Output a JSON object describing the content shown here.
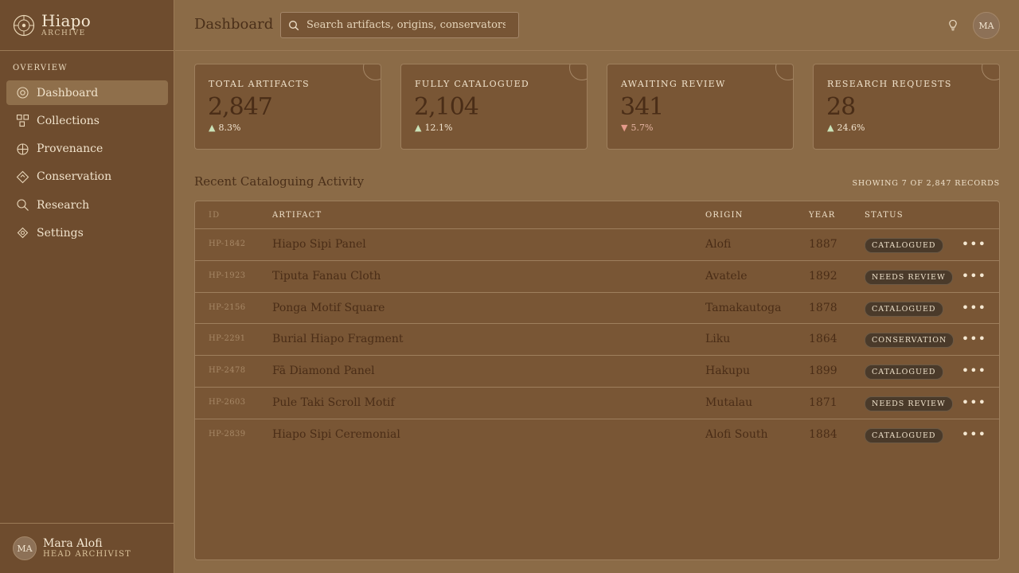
{
  "brand": {
    "name": "Hiapo",
    "subtitle": "ARCHIVE"
  },
  "sidebar": {
    "section": "OVERVIEW",
    "items": [
      {
        "label": "Dashboard",
        "icon": "dashboard-icon",
        "active": true
      },
      {
        "label": "Collections",
        "icon": "collections-icon"
      },
      {
        "label": "Provenance",
        "icon": "provenance-icon"
      },
      {
        "label": "Conservation",
        "icon": "conservation-icon"
      },
      {
        "label": "Research",
        "icon": "research-icon"
      },
      {
        "label": "Settings",
        "icon": "settings-icon"
      }
    ]
  },
  "user": {
    "initials": "MA",
    "name": "Mara Alofi",
    "role": "HEAD ARCHIVIST"
  },
  "header": {
    "title": "Dashboard",
    "search_placeholder": "Search artifacts, origins, conservators...",
    "avatar_initials": "MA"
  },
  "stats": [
    {
      "label": "TOTAL ARTIFACTS",
      "value": "2,847",
      "trend": "8.3%",
      "direction": "up"
    },
    {
      "label": "FULLY CATALOGUED",
      "value": "2,104",
      "trend": "12.1%",
      "direction": "up"
    },
    {
      "label": "AWAITING REVIEW",
      "value": "341",
      "trend": "5.7%",
      "direction": "down"
    },
    {
      "label": "RESEARCH REQUESTS",
      "value": "28",
      "trend": "24.6%",
      "direction": "up"
    }
  ],
  "activity": {
    "title": "Recent Cataloguing Activity",
    "meta": "SHOWING 7 OF 2,847 RECORDS",
    "columns": {
      "id": "ID",
      "artifact": "ARTIFACT",
      "origin": "ORIGIN",
      "year": "YEAR",
      "status": "STATUS"
    },
    "rows": [
      {
        "id": "HP-1842",
        "artifact": "Hiapo Sipi Panel",
        "origin": "Alofi",
        "year": "1887",
        "status": "CATALOGUED"
      },
      {
        "id": "HP-1923",
        "artifact": "Tiputa Fanau Cloth",
        "origin": "Avatele",
        "year": "1892",
        "status": "NEEDS REVIEW"
      },
      {
        "id": "HP-2156",
        "artifact": "Ponga Motif Square",
        "origin": "Tamakautoga",
        "year": "1878",
        "status": "CATALOGUED"
      },
      {
        "id": "HP-2291",
        "artifact": "Burial Hiapo Fragment",
        "origin": "Liku",
        "year": "1864",
        "status": "CONSERVATION"
      },
      {
        "id": "HP-2478",
        "artifact": "Fā Diamond Panel",
        "origin": "Hakupu",
        "year": "1899",
        "status": "CATALOGUED"
      },
      {
        "id": "HP-2603",
        "artifact": "Pule Taki Scroll Motif",
        "origin": "Mutalau",
        "year": "1871",
        "status": "NEEDS REVIEW"
      },
      {
        "id": "HP-2839",
        "artifact": "Hiapo Sipi Ceremonial",
        "origin": "Alofi South",
        "year": "1884",
        "status": "CATALOGUED"
      }
    ]
  },
  "colors": {
    "sidebar": "#6e4c2e",
    "background": "#8b6b47",
    "card": "#795635",
    "text_dark": "#4a2d17",
    "trend_up": "#c9e2b8",
    "trend_down": "#e49a8a"
  }
}
